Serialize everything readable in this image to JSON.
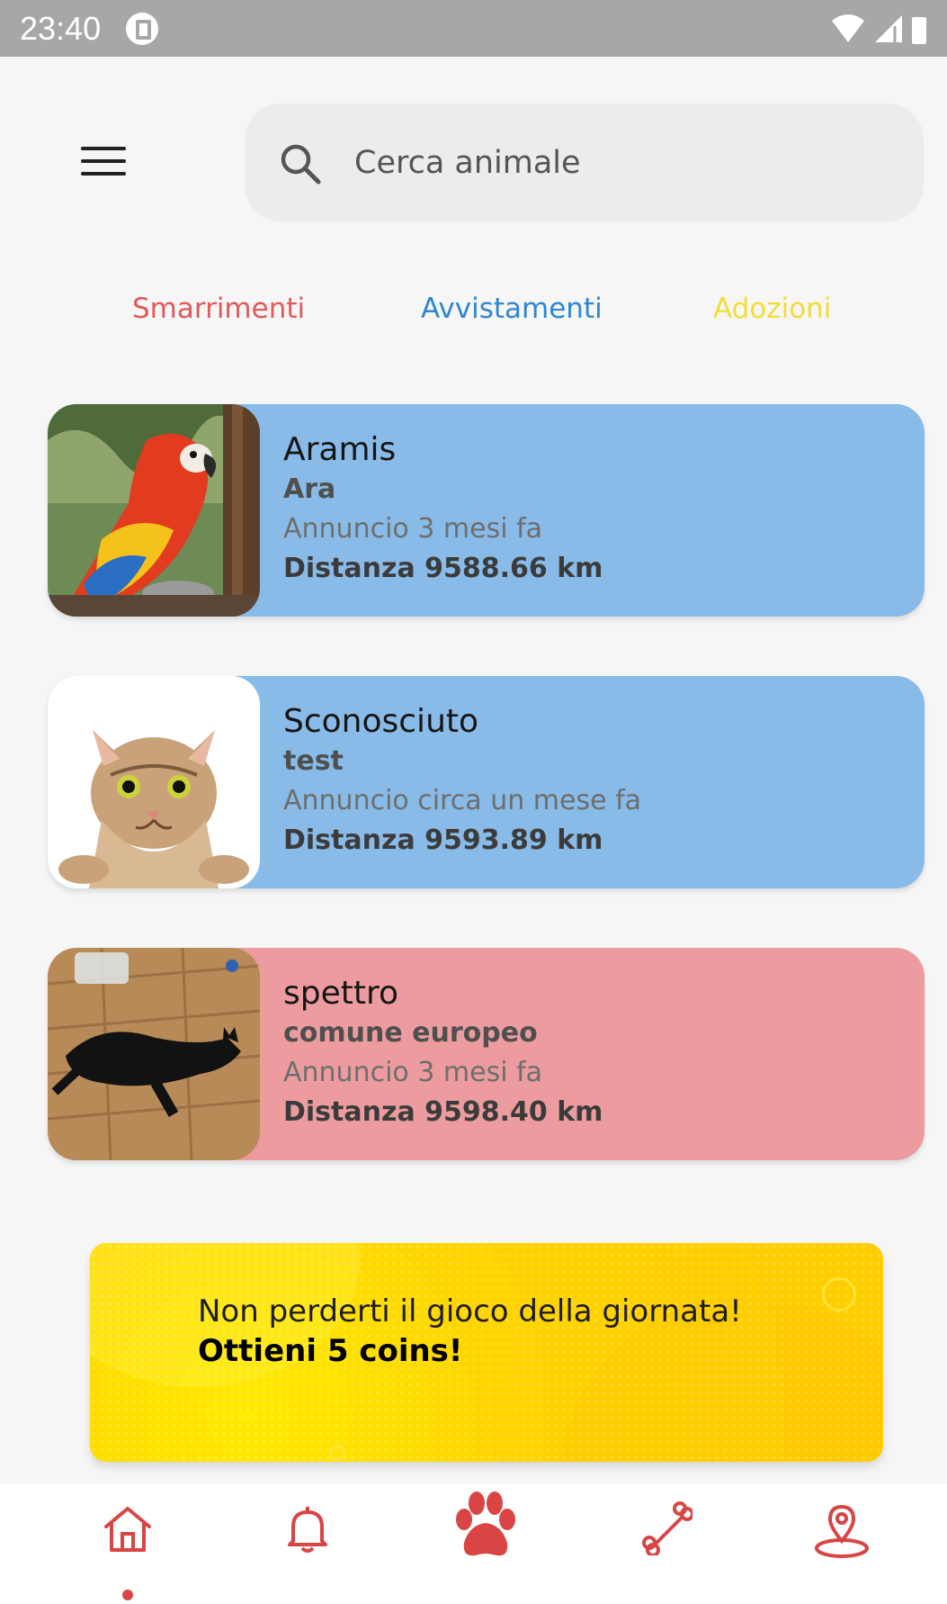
{
  "status_bar": {
    "time": "23:40"
  },
  "search": {
    "placeholder": "Cerca animale"
  },
  "tabs": [
    {
      "label": "Smarrimenti",
      "color": "#e05a5a"
    },
    {
      "label": "Avvistamenti",
      "color": "#2f86d4"
    },
    {
      "label": "Adozioni",
      "color": "#f1dd3a"
    }
  ],
  "listings": [
    {
      "name": "Aramis",
      "breed": "Ara",
      "posted": "Annuncio 3 mesi fa",
      "distance": "Distanza 9588.66 km",
      "card_color": "#88bbe7",
      "image": "parrot"
    },
    {
      "name": "Sconosciuto",
      "breed": "test",
      "posted": "Annuncio circa un mese fa",
      "distance": "Distanza 9593.89 km",
      "card_color": "#88bbe7",
      "image": "cat"
    },
    {
      "name": "spettro",
      "breed": "comune europeo",
      "posted": "Annuncio 3 mesi fa",
      "distance": "Distanza 9598.40 km",
      "card_color": "#ec9c9e",
      "image": "black-cat"
    }
  ],
  "banner": {
    "line1": "Non perderti il gioco della giornata!",
    "line2": "Ottieni 5 coins!"
  },
  "bottom_nav": {
    "active": "home",
    "items": [
      "home-icon",
      "bell-icon",
      "paw-icon",
      "bone-icon",
      "location-icon"
    ],
    "accent": "#d94545"
  }
}
